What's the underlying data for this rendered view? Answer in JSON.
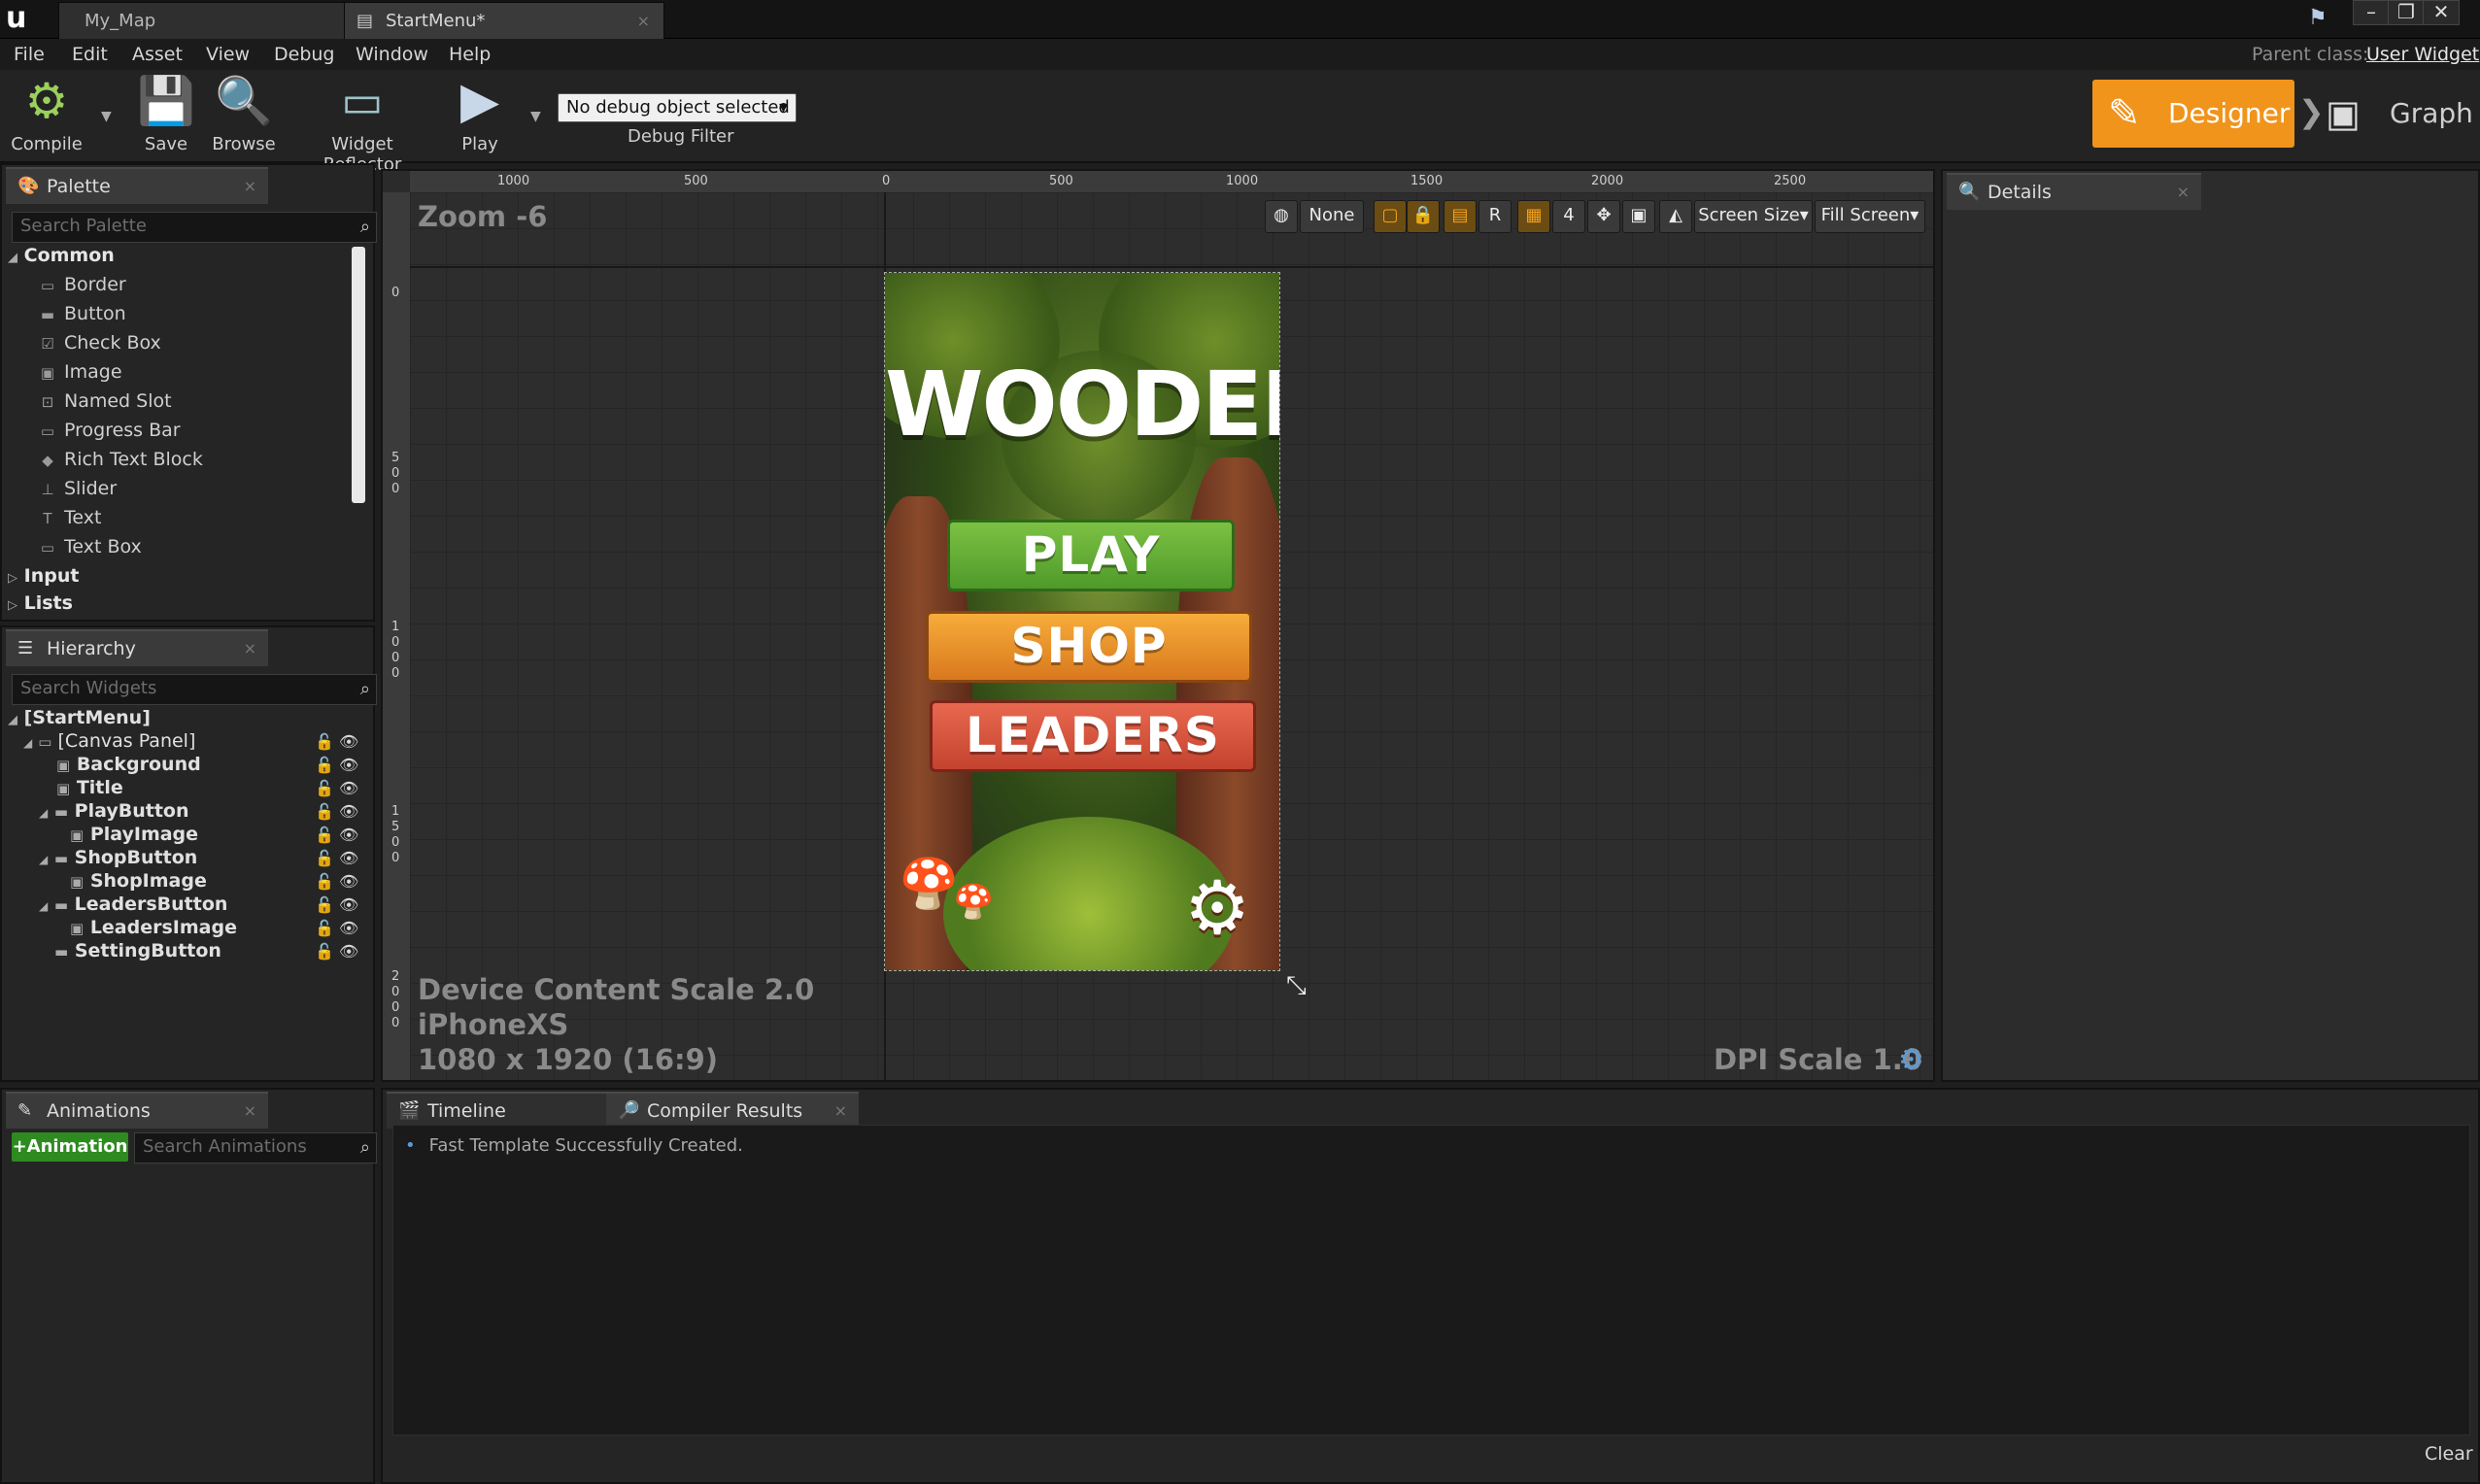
{
  "window": {
    "tabs": [
      {
        "label": "My_Map",
        "active": false
      },
      {
        "label": "StartMenu*",
        "active": true
      }
    ],
    "tab_close": "×",
    "controls": [
      "–",
      "❐",
      "✕"
    ]
  },
  "menu": {
    "items": [
      "File",
      "Edit",
      "Asset",
      "View",
      "Debug",
      "Window",
      "Help"
    ],
    "parent_class_label": "Parent class:",
    "parent_class_value": "User Widget"
  },
  "toolbar": {
    "compile": "Compile",
    "save": "Save",
    "browse": "Browse",
    "widget_reflector": "Widget Reflector",
    "play": "Play",
    "debug_dropdown": "No debug object selected",
    "debug_filter": "Debug Filter"
  },
  "modes": {
    "designer": "Designer",
    "graph": "Graph"
  },
  "palette": {
    "tab": "Palette",
    "search_placeholder": "Search Palette",
    "categories": {
      "common": "Common",
      "input": "Input",
      "lists": "Lists"
    },
    "items": [
      "Border",
      "Button",
      "Check Box",
      "Image",
      "Named Slot",
      "Progress Bar",
      "Rich Text Block",
      "Slider",
      "Text",
      "Text Box"
    ]
  },
  "hierarchy": {
    "tab": "Hierarchy",
    "search_placeholder": "Search Widgets",
    "root": "[StartMenu]",
    "items": [
      {
        "label": "[Canvas Panel]",
        "bold": false
      },
      {
        "label": "Background",
        "bold": true
      },
      {
        "label": "Title",
        "bold": true
      },
      {
        "label": "PlayButton",
        "bold": true
      },
      {
        "label": "PlayImage",
        "bold": true
      },
      {
        "label": "ShopButton",
        "bold": true
      },
      {
        "label": "ShopImage",
        "bold": true
      },
      {
        "label": "LeadersButton",
        "bold": true
      },
      {
        "label": "LeadersImage",
        "bold": true
      },
      {
        "label": "SettingButton",
        "bold": true
      }
    ]
  },
  "viewport": {
    "zoom": "Zoom -6",
    "ruler_h": [
      "1000",
      "500",
      "0",
      "500",
      "1000",
      "1500",
      "2000",
      "2500"
    ],
    "ruler_v": [
      "0",
      "500",
      "1000",
      "1500",
      "2000"
    ],
    "none_btn": "None",
    "r_btn": "R",
    "grid_value": "4",
    "screen_size": "Screen Size",
    "fill_screen": "Fill Screen",
    "device_scale": "Device Content Scale 2.0",
    "device_name": "iPhoneXS",
    "resolution": "1080 x 1920 (16:9)",
    "dpi_scale": "DPI Scale 1.0"
  },
  "preview": {
    "title": "WOODEN",
    "play": "PLAY",
    "shop": "SHOP",
    "leaders": "LEADERS",
    "colors": {
      "play": "#5aa832",
      "shop": "#e8902a",
      "leaders": "#d8553f"
    }
  },
  "details": {
    "tab": "Details"
  },
  "animations": {
    "tab": "Animations",
    "add_button": "+Animation",
    "search_placeholder": "Search Animations"
  },
  "bottom": {
    "tabs": [
      "Timeline",
      "Compiler Results"
    ],
    "message": "Fast Template Successfully Created.",
    "clear": "Clear"
  },
  "colors": {
    "accent": "#f39c12",
    "background": "#1e1e1e",
    "panel": "#252525"
  }
}
